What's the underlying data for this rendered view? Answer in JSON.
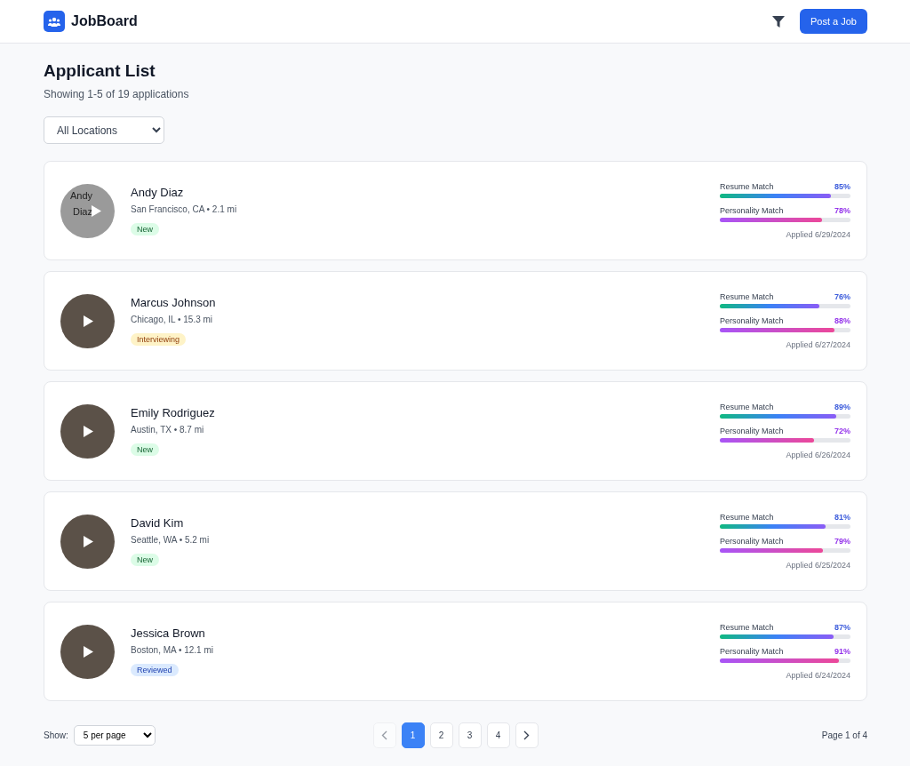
{
  "header": {
    "brand": "JobBoard",
    "post_button": "Post a Job"
  },
  "page": {
    "title": "Applicant List",
    "subtitle": "Showing 1-5 of 19 applications",
    "location_filter": "All Locations"
  },
  "applicants": [
    {
      "name": "Andy Diaz",
      "location": "San Francisco, CA • 2.1 mi",
      "status": "New",
      "kind": "new",
      "avatar_alt": "Andy Diaz",
      "photo": false,
      "metrics": [
        {
          "label": "Resume Match",
          "reading": "85%",
          "level": 0.85,
          "kind": "resume"
        },
        {
          "label": "Personality Match",
          "reading": "78%",
          "level": 0.78,
          "kind": "personality"
        }
      ],
      "applied": "Applied 6/29/2024"
    },
    {
      "name": "Marcus Johnson",
      "location": "Chicago, IL • 15.3 mi",
      "status": "Interviewing",
      "kind": "interviewing",
      "photo": true,
      "metrics": [
        {
          "label": "Resume Match",
          "reading": "76%",
          "level": 0.76,
          "kind": "resume"
        },
        {
          "label": "Personality Match",
          "reading": "88%",
          "level": 0.88,
          "kind": "personality"
        }
      ],
      "applied": "Applied 6/27/2024"
    },
    {
      "name": "Emily Rodriguez",
      "location": "Austin, TX • 8.7 mi",
      "status": "New",
      "kind": "new",
      "photo": true,
      "metrics": [
        {
          "label": "Resume Match",
          "reading": "89%",
          "level": 0.89,
          "kind": "resume"
        },
        {
          "label": "Personality Match",
          "reading": "72%",
          "level": 0.72,
          "kind": "personality"
        }
      ],
      "applied": "Applied 6/26/2024"
    },
    {
      "name": "David Kim",
      "location": "Seattle, WA • 5.2 mi",
      "status": "New",
      "kind": "new",
      "photo": true,
      "metrics": [
        {
          "label": "Resume Match",
          "reading": "81%",
          "level": 0.81,
          "kind": "resume"
        },
        {
          "label": "Personality Match",
          "reading": "79%",
          "level": 0.79,
          "kind": "personality"
        }
      ],
      "applied": "Applied 6/25/2024"
    },
    {
      "name": "Jessica Brown",
      "location": "Boston, MA • 12.1 mi",
      "status": "Reviewed",
      "kind": "reviewed",
      "photo": true,
      "metrics": [
        {
          "label": "Resume Match",
          "reading": "87%",
          "level": 0.87,
          "kind": "resume"
        },
        {
          "label": "Personality Match",
          "reading": "91%",
          "level": 0.91,
          "kind": "personality"
        }
      ],
      "applied": "Applied 6/24/2024"
    }
  ],
  "footer": {
    "show_label": "Show:",
    "per_page": "5 per page",
    "prev_disabled": true,
    "pages": [
      {
        "label": "1",
        "selected": true
      },
      {
        "label": "2",
        "selected": false
      },
      {
        "label": "3",
        "selected": false
      },
      {
        "label": "4",
        "selected": false
      }
    ],
    "page_info": "Page 1 of 4"
  }
}
